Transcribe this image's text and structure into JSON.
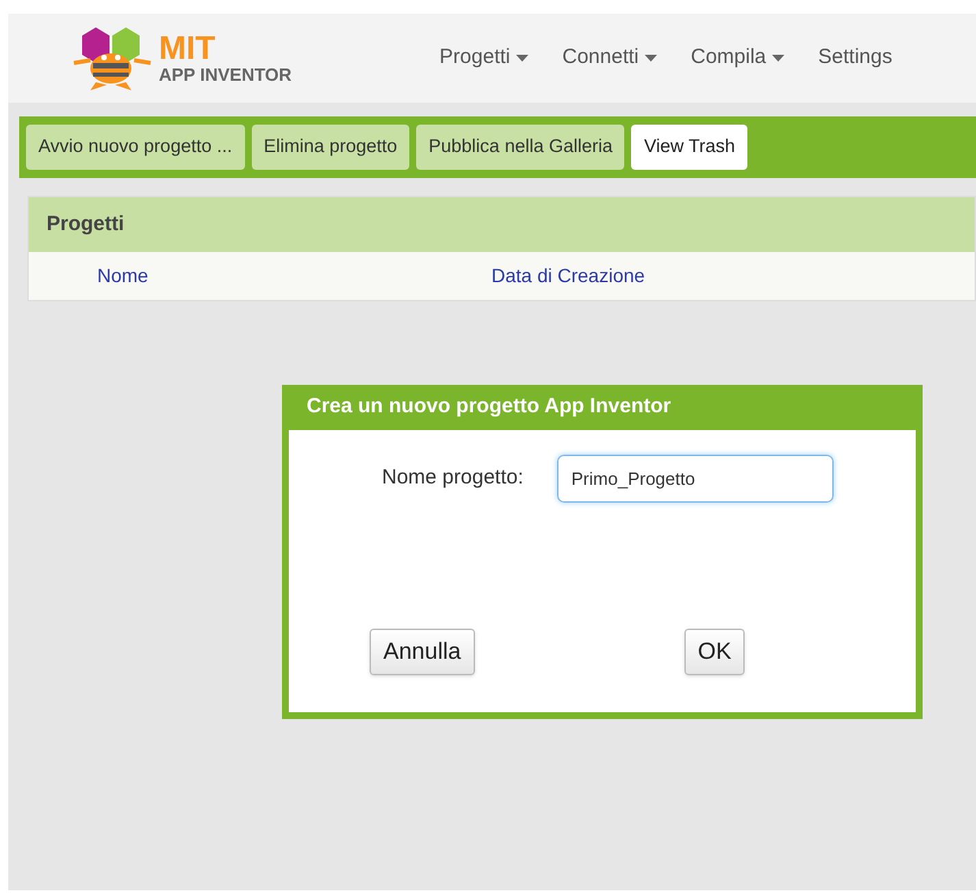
{
  "logo": {
    "title": "MIT",
    "subtitle": "APP INVENTOR"
  },
  "menu": [
    {
      "label": "Progetti",
      "dropdown": true
    },
    {
      "label": "Connetti",
      "dropdown": true
    },
    {
      "label": "Compila",
      "dropdown": true
    },
    {
      "label": "Settings",
      "dropdown": false
    }
  ],
  "toolbar": [
    {
      "label": "Avvio nuovo progetto ...",
      "kind": "action"
    },
    {
      "label": "Elimina progetto",
      "kind": "action"
    },
    {
      "label": "Pubblica nella Galleria",
      "kind": "action"
    },
    {
      "label": "View Trash",
      "kind": "plain"
    }
  ],
  "projects": {
    "title": "Progetti",
    "columns": [
      "Nome",
      "Data di Creazione"
    ]
  },
  "dialog": {
    "title": "Crea un nuovo progetto App Inventor",
    "field_label": "Nome progetto:",
    "field_value": "Primo_Progetto",
    "buttons": [
      "Annulla",
      "OK"
    ]
  }
}
